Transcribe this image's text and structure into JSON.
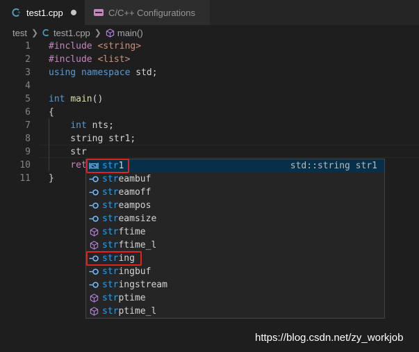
{
  "tabs": [
    {
      "label": "test1.cpp",
      "icon": "cpp-file-icon",
      "modified": true
    },
    {
      "label": "C/C++ Configurations",
      "icon": "settings-ui-icon"
    }
  ],
  "breadcrumb": {
    "folder": "test",
    "file": "test1.cpp",
    "symbol": "main()"
  },
  "code_lines": [
    {
      "n": "1",
      "tokens": [
        [
          "pre",
          "#include "
        ],
        [
          "str",
          "<string>"
        ]
      ]
    },
    {
      "n": "2",
      "tokens": [
        [
          "pre",
          "#include "
        ],
        [
          "str",
          "<list>"
        ]
      ]
    },
    {
      "n": "3",
      "tokens": [
        [
          "kw",
          "using "
        ],
        [
          "kw",
          "namespace "
        ],
        [
          "plain",
          "std;"
        ]
      ]
    },
    {
      "n": "4",
      "tokens": []
    },
    {
      "n": "5",
      "tokens": [
        [
          "kw",
          "int "
        ],
        [
          "fn",
          "main"
        ],
        [
          "plain",
          "()"
        ]
      ]
    },
    {
      "n": "6",
      "tokens": [
        [
          "plain",
          "{"
        ]
      ]
    },
    {
      "n": "7",
      "tokens": [
        [
          "plain",
          "    "
        ],
        [
          "kw",
          "int "
        ],
        [
          "plain",
          "nts;"
        ]
      ]
    },
    {
      "n": "8",
      "tokens": [
        [
          "plain",
          "    string str1;"
        ]
      ]
    },
    {
      "n": "9",
      "tokens": [
        [
          "plain",
          "    str"
        ]
      ]
    },
    {
      "n": "10",
      "tokens": [
        [
          "plain",
          "    "
        ],
        [
          "pre",
          "ret"
        ]
      ]
    },
    {
      "n": "11",
      "tokens": [
        [
          "plain",
          "}"
        ]
      ]
    }
  ],
  "suggestions": [
    {
      "match": "str",
      "rest": "1",
      "icon": "variable-icon",
      "detail": "std::string str1",
      "selected": true
    },
    {
      "match": "str",
      "rest": "eambuf",
      "icon": "class-icon"
    },
    {
      "match": "str",
      "rest": "eamoff",
      "icon": "class-icon"
    },
    {
      "match": "str",
      "rest": "eampos",
      "icon": "class-icon"
    },
    {
      "match": "str",
      "rest": "eamsize",
      "icon": "class-icon"
    },
    {
      "match": "str",
      "rest": "ftime",
      "icon": "method-icon"
    },
    {
      "match": "str",
      "rest": "ftime_l",
      "icon": "method-icon"
    },
    {
      "match": "str",
      "rest": "ing",
      "icon": "class-icon"
    },
    {
      "match": "str",
      "rest": "ingbuf",
      "icon": "class-icon"
    },
    {
      "match": "str",
      "rest": "ingstream",
      "icon": "class-icon"
    },
    {
      "match": "str",
      "rest": "ptime",
      "icon": "method-icon"
    },
    {
      "match": "str",
      "rest": "ptime_l",
      "icon": "method-icon"
    }
  ],
  "watermark": "https://blog.csdn.net/zy_workjob",
  "colors": {
    "accent_match": "#18a3ff",
    "highlight_box": "#e0241b",
    "selected_row": "#062f4a"
  }
}
